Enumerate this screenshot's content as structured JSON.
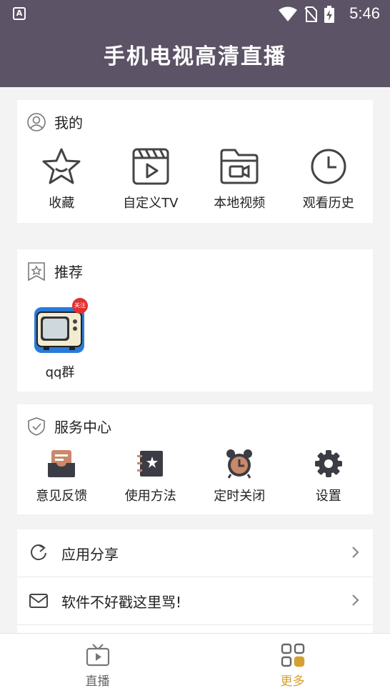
{
  "status_bar": {
    "time": "5:46",
    "app_badge": "A"
  },
  "header": {
    "title": "手机电视高清直播"
  },
  "mine": {
    "title": "我的",
    "items": [
      {
        "label": "收藏",
        "icon": "star-icon"
      },
      {
        "label": "自定义TV",
        "icon": "video-clapper-icon"
      },
      {
        "label": "本地视频",
        "icon": "video-folder-icon"
      },
      {
        "label": "观看历史",
        "icon": "clock-icon"
      }
    ]
  },
  "recommend": {
    "title": "推荐",
    "items": [
      {
        "label": "qq群",
        "badge": "关注",
        "icon": "tv-app-icon"
      }
    ]
  },
  "service": {
    "title": "服务中心",
    "items": [
      {
        "label": "意见反馈",
        "icon": "feedback-tray-icon"
      },
      {
        "label": "使用方法",
        "icon": "manual-book-icon"
      },
      {
        "label": "定时关闭",
        "icon": "alarm-clock-icon"
      },
      {
        "label": "设置",
        "icon": "gear-icon"
      }
    ]
  },
  "list": [
    {
      "label": "应用分享",
      "icon": "share-refresh-icon"
    },
    {
      "label": "软件不好戳这里骂!",
      "icon": "mail-icon"
    }
  ],
  "bottom_nav": {
    "tabs": [
      {
        "label": "直播",
        "icon": "tv-play-icon",
        "active": false
      },
      {
        "label": "更多",
        "icon": "grid-icon",
        "active": true
      }
    ],
    "active_color": "#d4a030",
    "inactive_color": "#666666"
  },
  "colors": {
    "header_bg": "#5c5366",
    "background": "#f3f3f4",
    "badge_red": "#e23030"
  }
}
